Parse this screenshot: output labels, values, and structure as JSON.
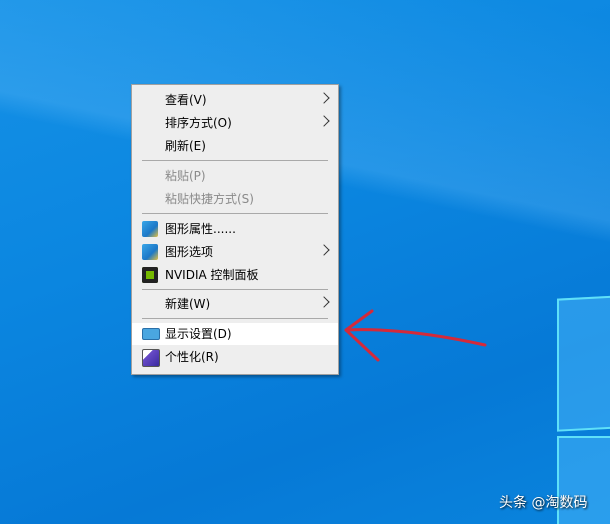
{
  "menu": {
    "items": [
      {
        "label": "查看(V)",
        "submenu": true
      },
      {
        "label": "排序方式(O)",
        "submenu": true
      },
      {
        "label": "刷新(E)"
      },
      {
        "label": "粘贴(P)",
        "disabled": true
      },
      {
        "label": "粘贴快捷方式(S)",
        "disabled": true
      },
      {
        "label": "图形属性......",
        "icon": "intel-graphics-icon"
      },
      {
        "label": "图形选项",
        "icon": "intel-graphics-icon",
        "submenu": true
      },
      {
        "label": "NVIDIA 控制面板",
        "icon": "nvidia-icon"
      },
      {
        "label": "新建(W)",
        "submenu": true
      },
      {
        "label": "显示设置(D)",
        "icon": "display-icon",
        "highlighted": true
      },
      {
        "label": "个性化(R)",
        "icon": "personalize-icon"
      }
    ]
  },
  "watermark": "头条 @淘数码",
  "colors": {
    "annotation": "#d42a3a",
    "highlight": "#ffffff"
  }
}
